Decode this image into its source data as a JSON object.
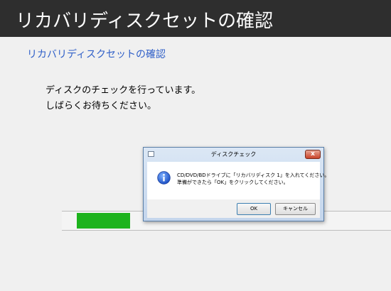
{
  "header": {
    "title": "リカバリディスクセットの確認"
  },
  "section": {
    "subtitle": "リカバリディスクセットの確認"
  },
  "message": {
    "line1": "ディスクのチェックを行っています。",
    "line2": "しばらくお待ちください。"
  },
  "progress": {
    "fraction": 0.17,
    "color": "#1db31d"
  },
  "dialog": {
    "title": "ディスクチェック",
    "text_line1": "CD/DVD/BDドライブに「リカバリディスク 1」を入れてください。",
    "text_line2": "準備ができたら「OK」をクリックしてください。",
    "ok_label": "OK",
    "cancel_label": "キャンセル",
    "close_glyph": "x",
    "icon": "info-icon"
  }
}
